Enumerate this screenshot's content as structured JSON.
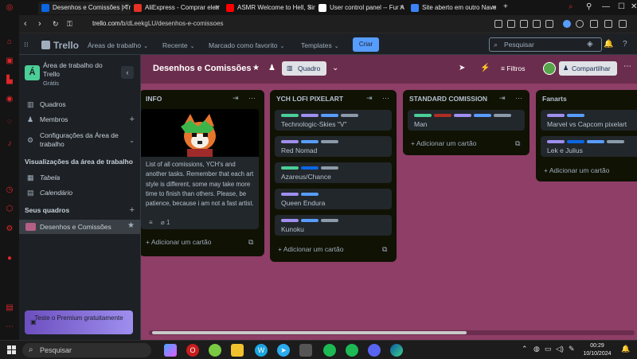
{
  "browser": {
    "tabs": [
      {
        "label": "Desenhos e Comissões | Tre",
        "active": true,
        "favicon_color": "#0c66e4"
      },
      {
        "label": "AliExpress - Comprar eletr",
        "active": false,
        "favicon_color": "#e43225"
      },
      {
        "label": "ASMR Welcome to Hell, Sin",
        "active": false,
        "favicon_color": "#ff0000"
      },
      {
        "label": "User control panel -- Fur A",
        "active": false,
        "favicon_color": "#ffffff"
      },
      {
        "label": "Site aberto em outro Nave",
        "active": false,
        "favicon_color": "#3b82f6"
      }
    ],
    "url_host": "trello.com",
    "url_path": "/b/dLeekgLU/desenhos-e-comissoes"
  },
  "header": {
    "logo": "Trello",
    "menus": [
      "Áreas de trabalho",
      "Recente",
      "Marcado como favorito",
      "Templates"
    ],
    "create_label": "Criar",
    "search_placeholder": "Pesquisar"
  },
  "workspace": {
    "avatar_letter": "Á",
    "name": "Área de trabalho do Trello",
    "plan": "Grátis",
    "nav": {
      "boards": "Quadros",
      "members": "Membros",
      "settings": "Configurações da Área de trabalho"
    },
    "views_heading": "Visualizações da área de trabalho",
    "views": [
      "Tabela",
      "Calendário"
    ],
    "my_boards_heading": "Seus quadros",
    "current_board": "Desenhos e Comissões",
    "premium": "Teste o Premium gratuitamente"
  },
  "board": {
    "title": "Desenhos e Comissões",
    "view_label": "Quadro",
    "filters_label": "Filtros",
    "share_label": "Compartilhar",
    "add_card_label": "Adicionar um cartão",
    "lists": [
      {
        "title": "INFO",
        "info_text": "List of all comissions, YCH's and another tasks. Remember that each art style is different, some may take more time to finish than others. Please, be patience, because i am not a fast artist.",
        "attachments": "1"
      },
      {
        "title": "YCH LOFI PIXELART",
        "cards": [
          {
            "text": "Technologic-Skies \"V\"",
            "labels": [
              "#4bce97",
              "#9f8fef",
              "#579dff",
              "#8c9bab"
            ]
          },
          {
            "text": "Red Nomad",
            "labels": [
              "#9f8fef",
              "#579dff",
              "#8c9bab"
            ]
          },
          {
            "text": "Azareus/Chance",
            "labels": [
              "#4bce97",
              "#0c66e4",
              "#8c9bab"
            ]
          },
          {
            "text": "Queen Endura",
            "labels": [
              "#9f8fef",
              "#579dff"
            ]
          },
          {
            "text": "Kunoku",
            "labels": [
              "#9f8fef",
              "#579dff",
              "#8c9bab"
            ]
          }
        ]
      },
      {
        "title": "STANDARD COMISSION",
        "cards": [
          {
            "text": "Man",
            "labels": [
              "#4bce97",
              "#ae2e24",
              "#9f8fef",
              "#579dff",
              "#8c9bab"
            ]
          }
        ]
      },
      {
        "title": "Fanarts",
        "cards": [
          {
            "text": "Marvel vs Capcom pixelart",
            "labels": [
              "#9f8fef",
              "#579dff"
            ]
          },
          {
            "text": "Lek e Julius",
            "labels": [
              "#9f8fef",
              "#0c66e4",
              "#579dff",
              "#8c9bab"
            ]
          }
        ]
      }
    ]
  },
  "taskbar": {
    "search_label": "Pesquisar",
    "time": "00:29",
    "date": "10/10/2024"
  }
}
